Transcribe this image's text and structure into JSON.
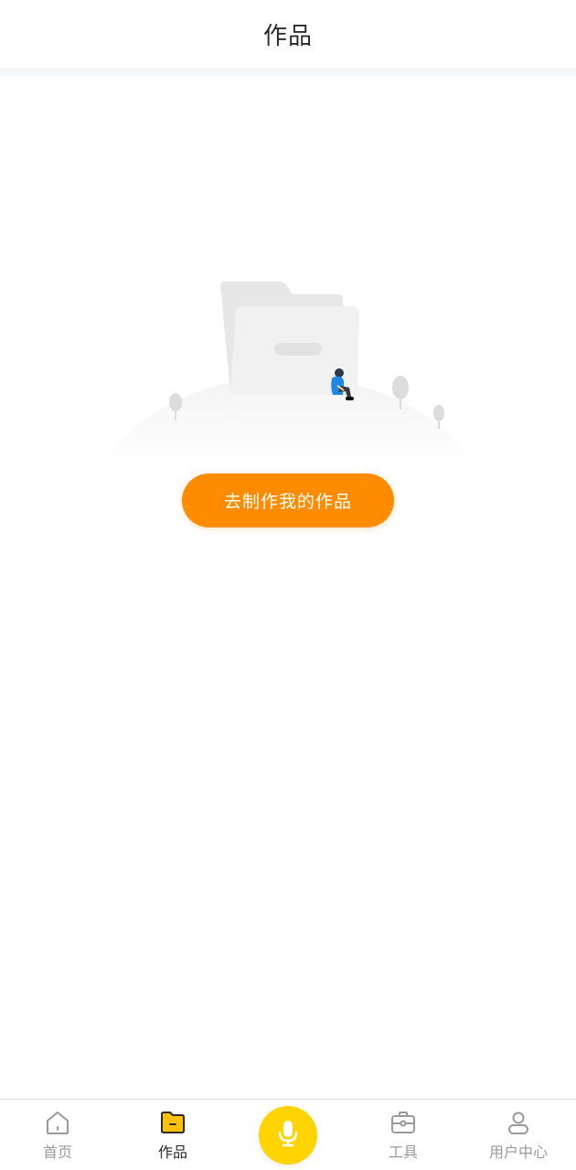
{
  "header": {
    "title": "作品"
  },
  "empty_state": {
    "illustration_icon": "empty-folder-illustration"
  },
  "cta": {
    "label": "去制作我的作品",
    "color": "#ff8c00"
  },
  "tabbar": {
    "tabs": [
      {
        "label": "首页",
        "icon": "home-icon",
        "active": false
      },
      {
        "label": "作品",
        "icon": "folder-icon",
        "active": true
      },
      {
        "label": "工具",
        "icon": "toolbox-icon",
        "active": false
      },
      {
        "label": "用户中心",
        "icon": "user-icon",
        "active": false
      }
    ],
    "center_button": {
      "icon": "microphone-icon",
      "color": "#ffd400"
    }
  }
}
